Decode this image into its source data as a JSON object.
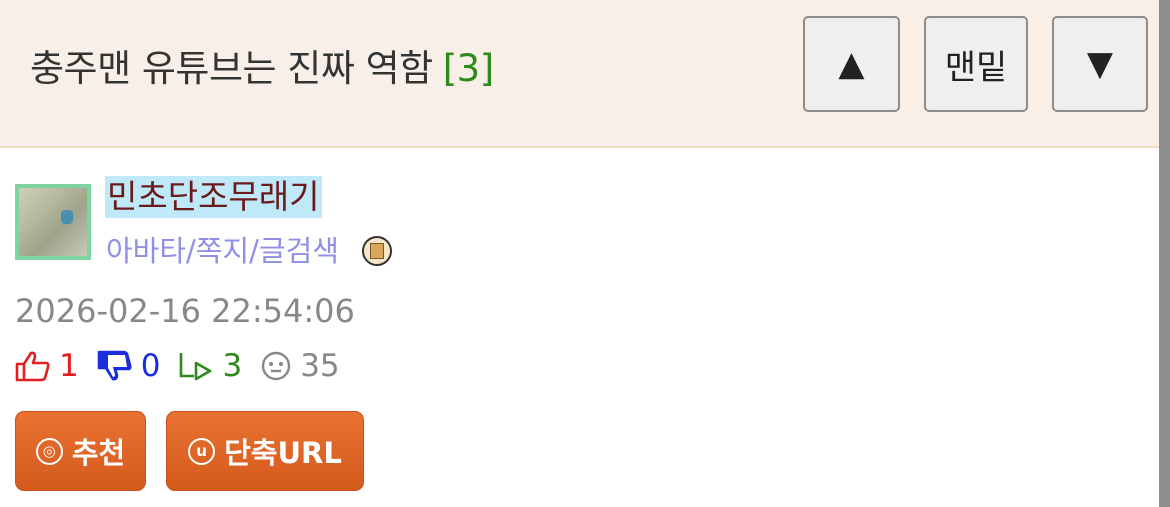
{
  "post": {
    "title": "충주맨 유튜브는 진짜 역함",
    "comment_count": "[3]"
  },
  "nav": {
    "up_label": "▲",
    "bottom_label": "맨밑",
    "down_label": "▼"
  },
  "author": {
    "name": "민초단조무래기",
    "links": "아바타/쪽지/글검색"
  },
  "meta": {
    "datetime": "2026-02-16 22:54:06"
  },
  "stats": {
    "likes": "1",
    "dislikes": "0",
    "replies": "3",
    "views": "35"
  },
  "actions": {
    "recommend_icon": "ⓞ",
    "recommend_label": "추천",
    "shorturl_icon": "u",
    "shorturl_label": "단축URL"
  },
  "colors": {
    "header_bg": "#f8f0e8",
    "accent_orange": "#e06a2a",
    "like_red": "#e02020",
    "dislike_blue": "#1a2ee0",
    "reply_green": "#2f8a1c"
  }
}
